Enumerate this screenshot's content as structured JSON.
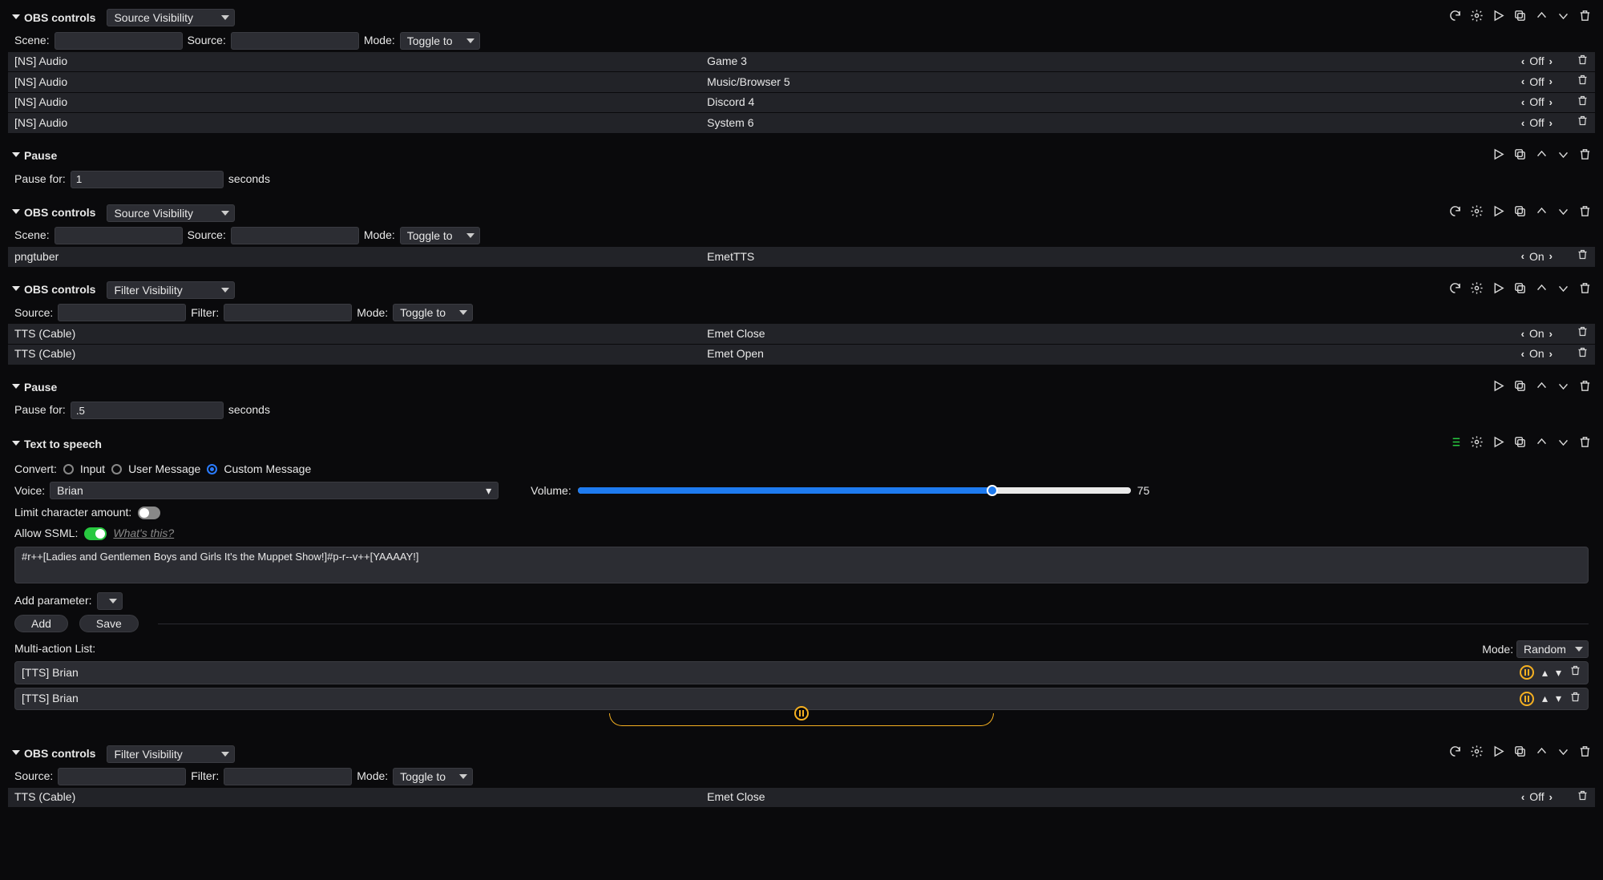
{
  "labels": {
    "scene": "Scene:",
    "source": "Source:",
    "filter": "Filter:",
    "mode": "Mode:",
    "pause_for": "Pause for:",
    "seconds": "seconds",
    "convert": "Convert:",
    "input_opt": "Input",
    "user_msg_opt": "User Message",
    "custom_msg_opt": "Custom Message",
    "voice": "Voice:",
    "volume": "Volume:",
    "limit_chars": "Limit character amount:",
    "allow_ssml": "Allow SSML:",
    "whats_this": "What's this?",
    "add_param": "Add parameter:",
    "add_btn": "Add",
    "save_btn": "Save",
    "multi_list": "Multi-action List:",
    "list_mode": "Mode:"
  },
  "modes": {
    "toggle_to": "Toggle to",
    "random": "Random"
  },
  "obs1": {
    "title": "OBS controls",
    "type": "Source Visibility",
    "mode": "Toggle to",
    "rows": [
      {
        "c1": "[NS] Audio",
        "c2": "Game 3",
        "state": "Off"
      },
      {
        "c1": "[NS] Audio",
        "c2": "Music/Browser 5",
        "state": "Off"
      },
      {
        "c1": "[NS] Audio",
        "c2": "Discord 4",
        "state": "Off"
      },
      {
        "c1": "[NS] Audio",
        "c2": "System 6",
        "state": "Off"
      }
    ]
  },
  "pause1": {
    "title": "Pause",
    "value": "1"
  },
  "obs2": {
    "title": "OBS controls",
    "type": "Source Visibility",
    "mode": "Toggle to",
    "rows": [
      {
        "c1": "pngtuber",
        "c2": "EmetTTS",
        "state": "On"
      }
    ]
  },
  "obs3": {
    "title": "OBS controls",
    "type": "Filter Visibility",
    "mode": "Toggle to",
    "rows": [
      {
        "c1": "TTS (Cable)",
        "c2": "Emet Close",
        "state": "On"
      },
      {
        "c1": "TTS (Cable)",
        "c2": "Emet Open",
        "state": "On"
      }
    ]
  },
  "pause2": {
    "title": "Pause",
    "value": ".5"
  },
  "tts": {
    "title": "Text to speech",
    "voice": "Brian",
    "volume": 75,
    "message": "#r++[Ladies and Gentlemen Boys and Girls It's the Muppet Show!]#p-r--v++[YAAAAY!]",
    "list_mode": "Random",
    "items": [
      {
        "label": "[TTS] Brian"
      },
      {
        "label": "[TTS] Brian"
      }
    ]
  },
  "obs4": {
    "title": "OBS controls",
    "type": "Filter Visibility",
    "mode": "Toggle to",
    "rows": [
      {
        "c1": "TTS (Cable)",
        "c2": "Emet Close",
        "state": "Off"
      }
    ]
  }
}
